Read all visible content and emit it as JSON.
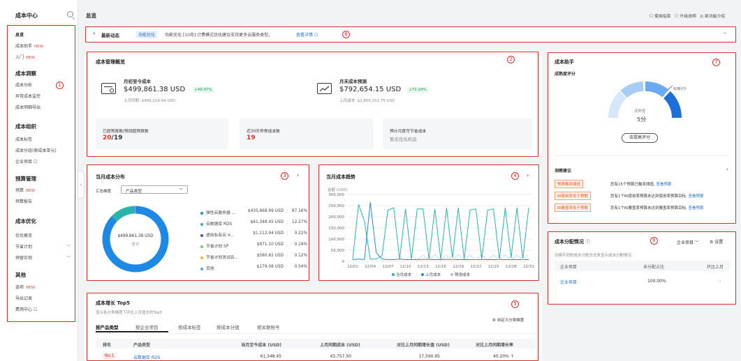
{
  "sidebar": {
    "title": "成本中心",
    "items": [
      {
        "label": "总览",
        "new": "",
        "chev": ""
      },
      {
        "label": "成本助手",
        "new": "NEW",
        "chev": ""
      },
      {
        "label": "入门",
        "new": "NEW",
        "chev": ""
      },
      {
        "label": "成本分析",
        "new": "",
        "chev": ""
      },
      {
        "label": "异常成本监控",
        "new": "",
        "chev": ""
      },
      {
        "label": "成本明细导出",
        "new": "",
        "chev": ""
      },
      {
        "label": "成本标签",
        "new": "",
        "chev": ""
      },
      {
        "label": "成本分组(原成本单元)",
        "new": "",
        "chev": ""
      },
      {
        "label": "企业项目 ☐",
        "new": "",
        "chev": ""
      },
      {
        "label": "预算",
        "new": "NEW",
        "chev": ""
      },
      {
        "label": "预算报告",
        "new": "",
        "chev": ""
      },
      {
        "label": "优化概览",
        "new": "",
        "chev": ""
      },
      {
        "label": "节省计划",
        "new": "",
        "chev": "﹀"
      },
      {
        "label": "预留实例",
        "new": "",
        "chev": "﹀"
      },
      {
        "label": "选项",
        "new": "NEW",
        "chev": ""
      },
      {
        "label": "导出记录",
        "new": "",
        "chev": ""
      },
      {
        "label": "费用中心 ☐",
        "new": "",
        "chev": ""
      }
    ],
    "heads": [
      "成本洞察",
      "成本组织",
      "预算管理",
      "成本优化",
      "其他"
    ]
  },
  "topbar": {
    "title": "总览",
    "links": [
      "使用指南",
      "升级说明",
      "新功能介绍"
    ]
  },
  "news": {
    "title": "最新动态",
    "tag": "功能优化",
    "text": "功能优化 [10月] 计费模式优化建议支持更多云服务类型。",
    "link": "查看详情 ☐"
  },
  "overview": {
    "title": "成本管理概览",
    "mtd_label": "月初至今成本",
    "mtd_value": "$499,861.38 USD",
    "mtd_change": "↓49.97%",
    "mtd_prev": "上月同期: $999,214.64 USD",
    "fc_label": "月末成本预测",
    "fc_value": "$792,654.15 USD",
    "fc_change": "↓72.24%",
    "fc_prev": "上月成本: $2,855,151.75 USD",
    "s1_label": "已超预算数/预测超预算数",
    "s1_a": "20",
    "s1_b": "/19",
    "s2_label": "近30天异常成本数",
    "s2_value": "19",
    "s3_label": "预计月度可节省成本",
    "s3_value": "暂无优化机会"
  },
  "assistant": {
    "title": "成本助手",
    "sub": "成熟度评分",
    "std": "标准分3",
    "maturity": "成熟度",
    "score": "5分",
    "button": "去提高评分",
    "sugg_title": "洞察建议",
    "suggestions": [
      {
        "tag": "预算触发阈值",
        "text": "您有15个预算已触发阈值,",
        "link": "查看预算"
      },
      {
        "tag": "RI使用率低于预期",
        "text": "您有1个RI使用率预算未达到使用率预算目标,",
        "link": "查看预算"
      },
      {
        "tag": "RI覆盖率低于预期",
        "text": "您有1个RI覆盖率预算未达到覆盖率预算目标,",
        "link": "查看预算"
      }
    ]
  },
  "dist": {
    "title": "当月成本分布",
    "dim_label": "汇总维度",
    "dim_value": "产品类型",
    "center_value": "$499,861.38 USD",
    "center_label": "总计",
    "legend": [
      {
        "name": "弹性云服务器 ...",
        "value": "$435,668.99 USD",
        "pct": "87.16%",
        "color": "#1e88e5"
      },
      {
        "name": "云数据库 RDS",
        "value": "$61,348.45 USD",
        "pct": "12.27%",
        "color": "#26b5a8"
      },
      {
        "name": "虚拟私有云 V...",
        "value": "$1,112.94 USD",
        "pct": "0.22%",
        "color": "#5b3fc7"
      },
      {
        "name": "节省计划 SP",
        "value": "$971.10 USD",
        "pct": "0.19%",
        "color": "#7cc576"
      },
      {
        "name": "节省计划测试云...",
        "value": "$580.82 USD",
        "pct": "0.12%",
        "color": "#f2b233"
      },
      {
        "name": "其他",
        "value": "$179.08 USD",
        "pct": "0.04%",
        "color": "#4aa6e8"
      }
    ]
  },
  "trend": {
    "title": "当月成本趋势",
    "unit": "金额 (USD)",
    "legend": [
      "当月成本",
      "上月成本",
      "预测成本"
    ]
  },
  "chart_data": {
    "type": "line",
    "ylabel": "金额 (USD)",
    "ylim": [
      0,
      300000
    ],
    "yticks": [
      "300,000",
      "250,000",
      "200,000",
      "150,000",
      "100,000",
      "50,000",
      "0"
    ],
    "xticks": [
      "12/01",
      "12/04",
      "12/07",
      "12/10",
      "12/13",
      "12/16",
      "12/19",
      "12/22",
      "12/25",
      "12/28",
      "12/31"
    ],
    "series": [
      {
        "name": "当月成本",
        "color": "#26b5a8",
        "values": [
          10000,
          255000,
          180000,
          10000,
          10000,
          25000,
          230000,
          240000,
          10000,
          235000,
          10000,
          235000,
          235000,
          10000,
          235000,
          10000,
          240000,
          15000,
          240000,
          10000,
          230000,
          235000,
          10000,
          230000,
          235000,
          10000,
          240000,
          15000,
          240000,
          12000,
          240000
        ]
      },
      {
        "name": "上月成本",
        "color": "#1e88e5",
        "values": [
          8000,
          10000,
          8000,
          265000,
          40000,
          10000,
          8000,
          8000,
          10000,
          8000,
          8000,
          8000,
          9000,
          8000,
          8000,
          8000,
          9000,
          8000,
          8000,
          8000,
          8000,
          8000,
          8000,
          8000,
          8000,
          8000,
          8000,
          8000,
          8000,
          8000,
          8000
        ]
      },
      {
        "name": "预测成本",
        "color": "#bbbbbb",
        "values": [
          null,
          null,
          null,
          null,
          null,
          null,
          null,
          null,
          null,
          null,
          30000,
          5000,
          28000,
          5000,
          30000,
          5000,
          28000,
          5000,
          30000,
          5000,
          28000,
          5000,
          30000,
          5000,
          28000,
          5000,
          30000,
          5000,
          28000,
          5000,
          30000
        ]
      }
    ]
  },
  "alloc": {
    "title": "成本分配情况",
    "desc": "切换不同的成本分配方式来显示成本分配情况。",
    "sel": "企业项目",
    "settings": "设置",
    "cols": [
      "企业项目",
      "未分配占比",
      "环比上月"
    ],
    "row": [
      "企业项目",
      "100.00%",
      "-"
    ]
  },
  "growth": {
    "title": "成本增长 Top5",
    "desc": "显示各分类维度下环比上月增长的Top5",
    "custom": "自定义分类维度",
    "tabs": [
      "按产品类型",
      "按企业项目",
      "按成本标签",
      "按成本分组",
      "按关联账号"
    ],
    "cols": [
      "排名",
      "产品类型",
      "当月至今成本 (USD)",
      "上月同期成本 (USD)",
      "对比上月同期增长值 (USD)",
      "对比上月同期增长率"
    ],
    "row": [
      "No.1",
      "云数据库 RDS",
      "61,348.45",
      "43,757.50",
      "17,590.95",
      "40.20%"
    ]
  },
  "markers": [
    "1",
    "2",
    "3",
    "4",
    "5",
    "6",
    "7",
    "8"
  ]
}
